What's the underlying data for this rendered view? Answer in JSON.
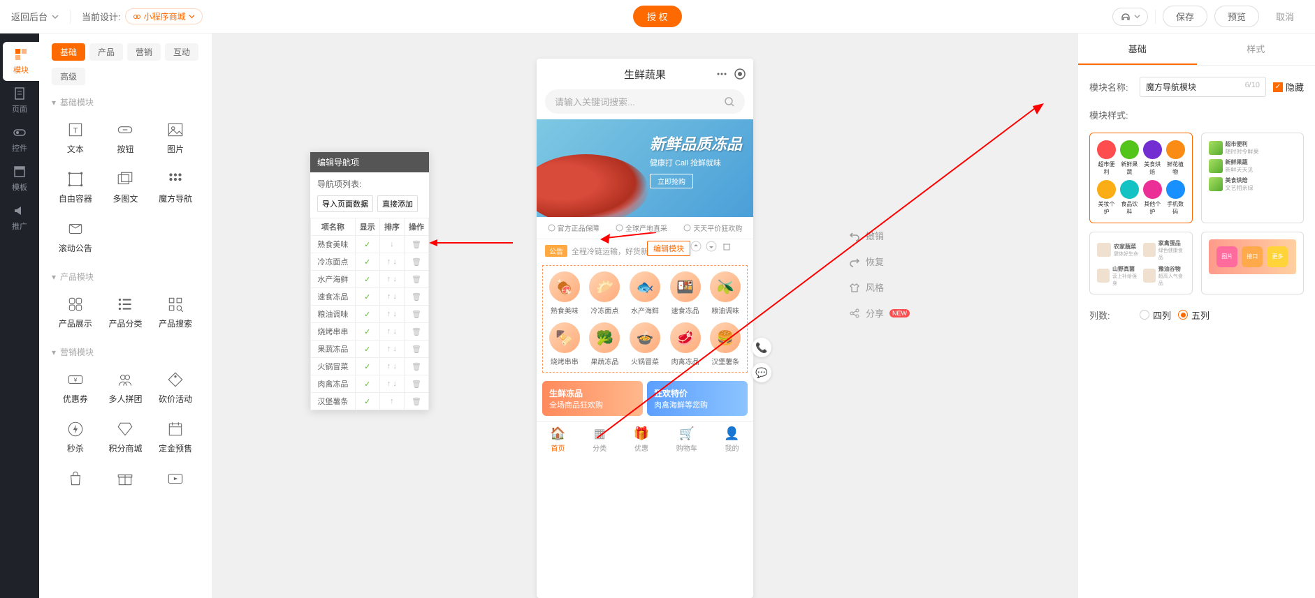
{
  "topbar": {
    "back": "返回后台",
    "current_design_label": "当前设计:",
    "current_design_value": "小程序商城",
    "authorize": "授 权",
    "save": "保存",
    "preview": "预览",
    "cancel": "取消"
  },
  "rail": [
    {
      "id": "module",
      "label": "模块",
      "active": true
    },
    {
      "id": "page",
      "label": "页面",
      "active": false
    },
    {
      "id": "control",
      "label": "控件",
      "active": false
    },
    {
      "id": "template",
      "label": "模板",
      "active": false
    },
    {
      "id": "promote",
      "label": "推广",
      "active": false
    }
  ],
  "comp_tabs": {
    "row1": [
      {
        "label": "基础",
        "active": true
      },
      {
        "label": "产品",
        "active": false
      },
      {
        "label": "营销",
        "active": false
      },
      {
        "label": "互动",
        "active": false
      }
    ],
    "row2": [
      {
        "label": "高级",
        "active": false
      }
    ]
  },
  "comp_sections": [
    {
      "title": "基础模块",
      "items": [
        {
          "id": "text",
          "label": "文本"
        },
        {
          "id": "button",
          "label": "按钮"
        },
        {
          "id": "image",
          "label": "图片"
        },
        {
          "id": "free",
          "label": "自由容器"
        },
        {
          "id": "multi",
          "label": "多图文"
        },
        {
          "id": "magic-nav",
          "label": "魔方导航"
        },
        {
          "id": "notice",
          "label": "滚动公告"
        }
      ]
    },
    {
      "title": "产品模块",
      "items": [
        {
          "id": "prod-show",
          "label": "产品展示"
        },
        {
          "id": "prod-cat",
          "label": "产品分类"
        },
        {
          "id": "prod-search",
          "label": "产品搜索"
        }
      ]
    },
    {
      "title": "营销模块",
      "items": [
        {
          "id": "coupon",
          "label": "优惠券"
        },
        {
          "id": "group",
          "label": "多人拼团"
        },
        {
          "id": "bargain",
          "label": "砍价活动"
        },
        {
          "id": "seckill",
          "label": "秒杀"
        },
        {
          "id": "points",
          "label": "积分商城"
        },
        {
          "id": "presale",
          "label": "定金预售"
        }
      ]
    }
  ],
  "edit_popup": {
    "title": "编辑导航项",
    "subtitle": "导航项列表:",
    "btn_import": "导入页面数据",
    "btn_add": "直接添加",
    "headers": [
      "项名称",
      "显示",
      "排序",
      "操作"
    ],
    "rows": [
      {
        "name": "熟食美味",
        "show": true,
        "up": false,
        "down": true
      },
      {
        "name": "冷冻面点",
        "show": true,
        "up": true,
        "down": true
      },
      {
        "name": "水产海鲜",
        "show": true,
        "up": true,
        "down": true
      },
      {
        "name": "速食冻品",
        "show": true,
        "up": true,
        "down": true
      },
      {
        "name": "粮油调味",
        "show": true,
        "up": true,
        "down": true
      },
      {
        "name": "烧烤串串",
        "show": true,
        "up": true,
        "down": true
      },
      {
        "name": "果蔬冻品",
        "show": true,
        "up": true,
        "down": true
      },
      {
        "name": "火锅冒菜",
        "show": true,
        "up": true,
        "down": true
      },
      {
        "name": "肉禽冻品",
        "show": true,
        "up": true,
        "down": true
      },
      {
        "name": "汉堡薯条",
        "show": true,
        "up": true,
        "down": false
      }
    ]
  },
  "phone": {
    "title": "生鲜蔬果",
    "search_placeholder": "请输入关键词搜索...",
    "banner": {
      "title": "新鲜品质冻品",
      "subtitle": "健康打 Call 抢鲜就味",
      "cta": "立即抢购"
    },
    "strip": [
      "官方正品保障",
      "全球产地直采",
      "天天平价狂欢购"
    ],
    "notice": "全程冷链运输，好货新",
    "edit_badge": "编辑模块",
    "nav_items": [
      "熟食美味",
      "冷冻面点",
      "水产海鲜",
      "速食冻品",
      "粮油调味",
      "烧烤串串",
      "果蔬冻品",
      "火锅冒菜",
      "肉禽冻品",
      "汉堡薯条"
    ],
    "promo": [
      {
        "title": "生鲜冻品",
        "sub": "全场商品狂欢购"
      },
      {
        "title": "狂欢特价",
        "sub": "肉禽海鲜等您购"
      }
    ],
    "tabbar": [
      {
        "label": "首页",
        "active": true
      },
      {
        "label": "分类",
        "active": false
      },
      {
        "label": "优惠",
        "active": false
      },
      {
        "label": "购物车",
        "active": false
      },
      {
        "label": "我的",
        "active": false
      }
    ]
  },
  "canvas_tools": [
    {
      "id": "undo",
      "label": "撤销"
    },
    {
      "id": "redo",
      "label": "恢复"
    },
    {
      "id": "style",
      "label": "风格"
    },
    {
      "id": "share",
      "label": "分享",
      "badge": "NEW"
    }
  ],
  "inspector": {
    "tabs": [
      {
        "label": "基础",
        "active": true
      },
      {
        "label": "样式",
        "active": false
      }
    ],
    "name_label": "模块名称:",
    "name_value": "魔方导航模块",
    "name_count": "6/10",
    "hide_label": "隐藏",
    "style_label": "模块样式:",
    "style1_items": [
      {
        "label": "超市便利",
        "color": "#ff4d4f"
      },
      {
        "label": "新鲜果蔬",
        "color": "#52c41a"
      },
      {
        "label": "美食烘焙",
        "color": "#722ed1"
      },
      {
        "label": "鲜花植物",
        "color": "#fa8c16"
      },
      {
        "label": "美妆个护",
        "color": "#faad14"
      },
      {
        "label": "食品饮料",
        "color": "#13c2c2"
      },
      {
        "label": "其他个护",
        "color": "#eb2f96"
      },
      {
        "label": "手机数码",
        "color": "#1890ff"
      }
    ],
    "style2_items": [
      {
        "t1": "超市便利",
        "t2": "随时时令鲜果"
      },
      {
        "t1": "新鲜果蔬",
        "t2": "新鲜天天见"
      },
      {
        "t1": "美食烘焙",
        "t2": "文艺相亲绿"
      }
    ],
    "style3_items": [
      {
        "t1": "农家蔬菜",
        "t2": "健体好生命"
      },
      {
        "t1": "家禽蛋品",
        "t2": "绿色健康食品"
      },
      {
        "t1": "山野真菌",
        "t2": "营上补给强身"
      },
      {
        "t1": "豫油谷物",
        "t2": "超高人气食品"
      }
    ],
    "style4_items": [
      "图片",
      "接口",
      "更多"
    ],
    "cols_label": "列数:",
    "cols_4": "四列",
    "cols_5": "五列"
  }
}
